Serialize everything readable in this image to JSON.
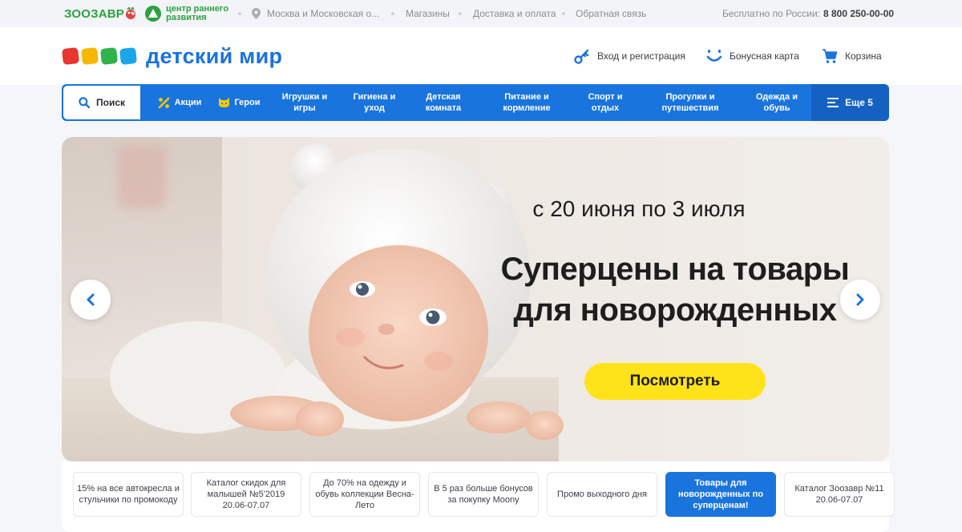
{
  "topbar": {
    "zoo_logo_a": "ЗООЗАВР",
    "center_line1": "центр раннего",
    "center_line2": "развития",
    "region": "Москва и Московская о...",
    "stores": "Магазины",
    "delivery": "Доставка и оплата",
    "feedback": "Обратная связь",
    "phone_label": "Бесплатно по России:",
    "phone_number": "8 800 250-00-00"
  },
  "header": {
    "logo_text": "детский мир",
    "logo_colors": [
      "#e8352f",
      "#f5b800",
      "#2fb34a",
      "#1aa6e8"
    ],
    "login": "Вход и регистрация",
    "bonus": "Бонусная карта",
    "cart": "Корзина"
  },
  "nav": {
    "search": "Поиск",
    "items": [
      {
        "label": "Акции",
        "icon": "percent-icon"
      },
      {
        "label": "Герои",
        "icon": "cat-icon"
      },
      {
        "label": "Игрушки и игры"
      },
      {
        "label": "Гигиена и уход"
      },
      {
        "label": "Детская комната"
      },
      {
        "label": "Питание и кормление"
      },
      {
        "label": "Спорт и отдых"
      },
      {
        "label": "Прогулки и путешествия"
      },
      {
        "label": "Одежда и обувь"
      }
    ],
    "more": "Еще 5"
  },
  "banner": {
    "date": "с 20 июня по 3 июля",
    "title_line1": "Суперцены на товары",
    "title_line2": "для новорожденных",
    "button": "Посмотреть"
  },
  "promos": [
    {
      "text": "15% на все автокресла и стульчики по промокоду",
      "active": false
    },
    {
      "text": "Каталог скидок для малышей №5'2019 20.06-07.07",
      "active": false
    },
    {
      "text": "До 70% на одежду и обувь коллекции Весна-Лето",
      "active": false
    },
    {
      "text": "В 5 раз больше бонусов за покупку Moony",
      "active": false
    },
    {
      "text": "Промо выходного дня",
      "active": false
    },
    {
      "text": "Товары для новорожденных по суперценам!",
      "active": true
    },
    {
      "text": "Каталог Зоозавр №11 20.06-07.07",
      "active": false
    }
  ]
}
